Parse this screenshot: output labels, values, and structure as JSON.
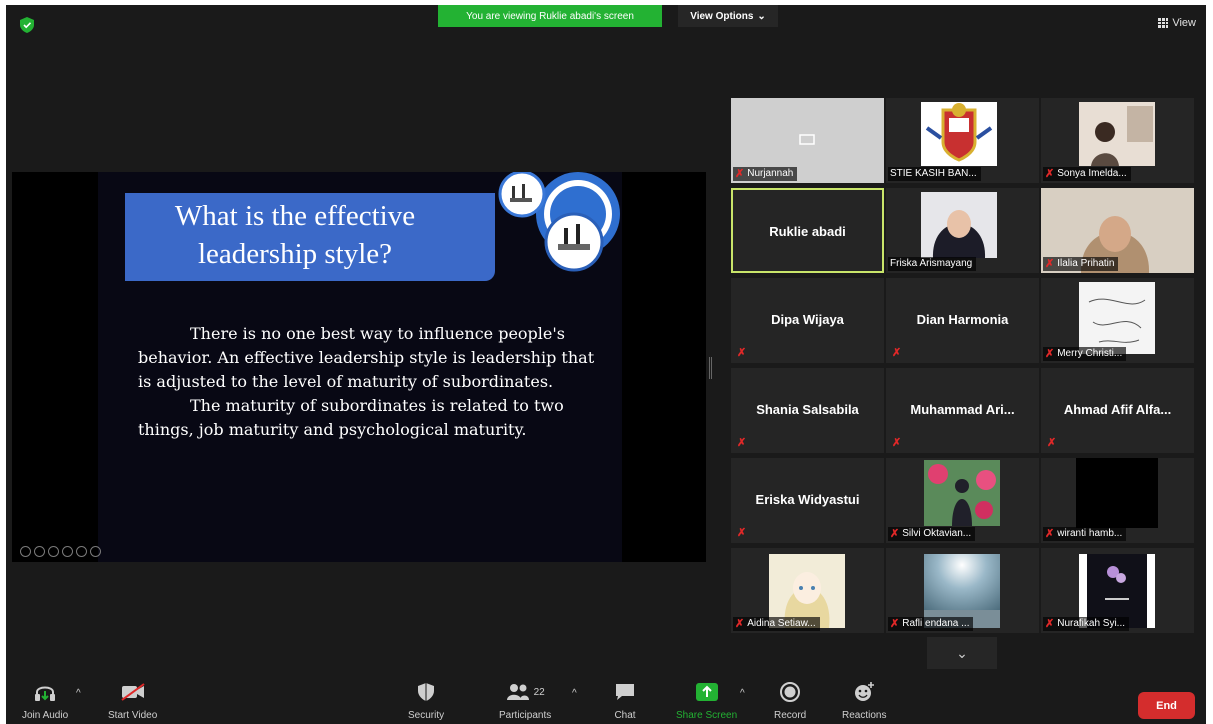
{
  "top_bar": {
    "banner_text": "You are viewing Ruklie abadi's screen",
    "view_options_label": "View Options",
    "view_label": "View"
  },
  "slide": {
    "title": "What is the effective leadership style?",
    "para1": "There is no one best way to influence people's behavior. An effective leadership style is leadership that is adjusted to the level of maturity of subordinates.",
    "para2": "The maturity of subordinates is related to two things, job maturity and psychological maturity."
  },
  "participants": [
    {
      "name": "Nurjannah",
      "type": "label"
    },
    {
      "name": "STIE KASIH BAN...",
      "type": "label"
    },
    {
      "name": "Sonya Imelda...",
      "type": "label"
    },
    {
      "name": "Ruklie abadi",
      "type": "center",
      "active": true
    },
    {
      "name": "Friska Arismayang",
      "type": "label"
    },
    {
      "name": "Ilalia Prihatin",
      "type": "label"
    },
    {
      "name": "Dipa Wijaya",
      "type": "center"
    },
    {
      "name": "Dian Harmonia",
      "type": "center"
    },
    {
      "name": "Merry Christi...",
      "type": "label"
    },
    {
      "name": "Shania Salsabila",
      "type": "center"
    },
    {
      "name": "Muhammad Ari...",
      "type": "center"
    },
    {
      "name": "Ahmad Afif Alfa...",
      "type": "center"
    },
    {
      "name": "Eriska Widyastui",
      "type": "center"
    },
    {
      "name": "Silvi Oktavian...",
      "type": "label"
    },
    {
      "name": "wiranti hamb...",
      "type": "label"
    },
    {
      "name": "Aidina Setiaw...",
      "type": "label"
    },
    {
      "name": "Rafli endana ...",
      "type": "label"
    },
    {
      "name": "Nurafikah Syi...",
      "type": "label"
    }
  ],
  "toolbar": {
    "join_audio": "Join Audio",
    "start_video": "Start Video",
    "security": "Security",
    "participants": "Participants",
    "participants_count": "22",
    "chat": "Chat",
    "share_screen": "Share Screen",
    "record": "Record",
    "reactions": "Reactions",
    "end": "End"
  },
  "colors": {
    "banner": "#23b233",
    "slide_title_bg": "#3b69c8",
    "end_button": "#d42d2d",
    "active_speaker_border": "#c9e56a",
    "mute_icon": "#e02828"
  },
  "icons": {
    "shield": "green-shield-icon",
    "view": "grid-icon",
    "join_audio": "headphones-icon",
    "start_video": "video-off-icon",
    "security": "shield-icon",
    "participants": "participants-icon",
    "chat": "chat-bubble-icon",
    "share_screen": "share-screen-arrow-icon",
    "record": "record-icon",
    "reactions": "smiley-plus-icon",
    "muted": "mic-muted-icon"
  }
}
